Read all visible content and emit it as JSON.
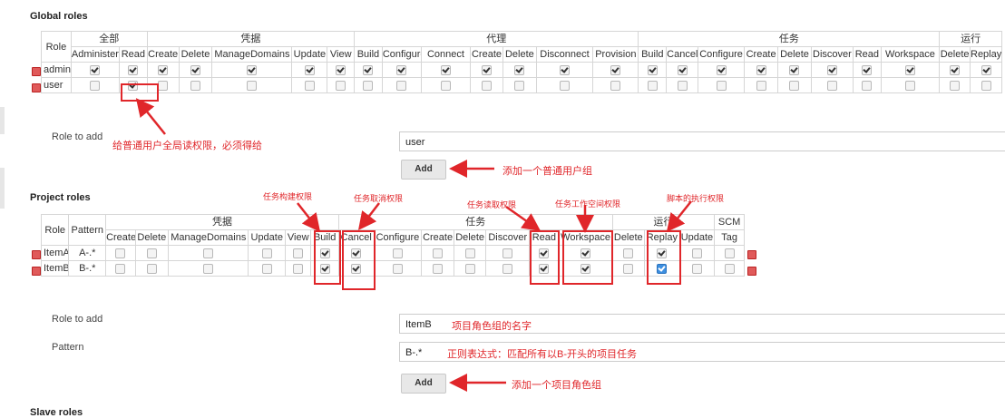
{
  "global": {
    "title": "Global roles",
    "role_header": "Role",
    "groups": [
      "全部",
      "凭据",
      "代理",
      "任务",
      "运行"
    ],
    "columns": [
      "Administer",
      "Read",
      "Create",
      "Delete",
      "ManageDomains",
      "Update",
      "View",
      "Build",
      "Configure",
      "Connect",
      "Create",
      "Delete",
      "Disconnect",
      "Provision",
      "Build",
      "Cancel",
      "Configure",
      "Create",
      "Delete",
      "Discover",
      "Read",
      "Workspace",
      "Delete",
      "Replay"
    ],
    "rows": [
      {
        "name": "admin",
        "checks": [
          1,
          1,
          1,
          1,
          1,
          1,
          1,
          1,
          1,
          1,
          1,
          1,
          1,
          1,
          1,
          1,
          1,
          1,
          1,
          1,
          1,
          1,
          1,
          1
        ]
      },
      {
        "name": "user",
        "checks": [
          0,
          1,
          0,
          0,
          0,
          0,
          0,
          0,
          0,
          0,
          0,
          0,
          0,
          0,
          0,
          0,
          0,
          0,
          0,
          0,
          0,
          0,
          0,
          0
        ]
      }
    ],
    "role_to_add_label": "Role to add",
    "role_to_add_value": "user",
    "add_label": "Add"
  },
  "project": {
    "title": "Project roles",
    "role_header": "Role",
    "pattern_header": "Pattern",
    "groups": [
      "凭据",
      "任务",
      "运行",
      "SCM"
    ],
    "columns": [
      "Create",
      "Delete",
      "ManageDomains",
      "Update",
      "View",
      "Build",
      "Cancel",
      "Configure",
      "Create",
      "Delete",
      "Discover",
      "Read",
      "Workspace",
      "Delete",
      "Replay",
      "Update",
      "Tag"
    ],
    "rows": [
      {
        "name": "ItemA",
        "pattern": "A-.*",
        "checks": [
          0,
          0,
          0,
          0,
          0,
          1,
          1,
          0,
          0,
          0,
          0,
          1,
          1,
          0,
          1,
          0,
          0
        ]
      },
      {
        "name": "ItemB",
        "pattern": "B-.*",
        "checks": [
          0,
          0,
          0,
          0,
          0,
          1,
          1,
          0,
          0,
          0,
          0,
          1,
          1,
          0,
          2,
          0,
          0
        ]
      }
    ],
    "role_to_add_label": "Role to add",
    "role_to_add_value": "ItemB",
    "pattern_label": "Pattern",
    "pattern_value": "B-.*",
    "add_label": "Add"
  },
  "slave": {
    "title": "Slave roles"
  },
  "annotations": {
    "global_read": "给普通用户全局读权限，必须得给",
    "add_user_group": "添加一个普通用户组",
    "build": "任务构建权限",
    "cancel": "任务取消权限",
    "read": "任务读取权限",
    "workspace": "任务工作空间权限",
    "replay": "脚本的执行权限",
    "item_name": "项目角色组的名字",
    "pattern_desc": "正则表达式：匹配所有以B-开头的项目任务",
    "add_project_group": "添加一个项目角色组"
  },
  "colors": {
    "annotation": "#e0262a",
    "delete_icon": "#e05a5a",
    "border": "#d6d6d6"
  }
}
